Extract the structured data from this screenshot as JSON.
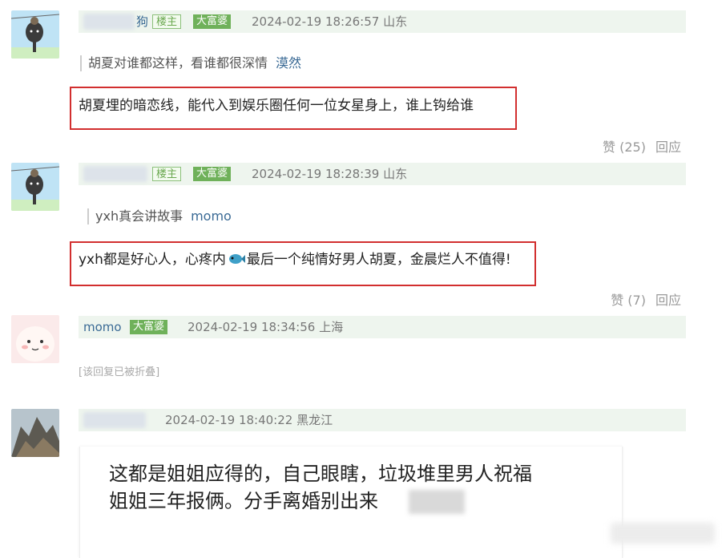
{
  "posts": [
    {
      "user_suffix": "狗",
      "badge_owner": "楼主",
      "badge_rich": "大富婆",
      "time": "2024-02-19 18:26:57 山东",
      "quote": "胡夏对谁都这样，看谁都很深情",
      "quote_user": "漠然",
      "content": "胡夏埋的暗恋线，能代入到娱乐圈任何一位女星身上，谁上钩给谁",
      "like": "赞 (25)",
      "reply": "回应"
    },
    {
      "badge_owner": "楼主",
      "badge_rich": "大富婆",
      "time": "2024-02-19 18:28:39 山东",
      "quote": "yxh真会讲故事",
      "quote_user": "momo",
      "content_a": "yxh都是好心人，心疼内",
      "content_b": "最后一个纯情好男人胡夏，金晨烂人不值得!",
      "like": "赞 (7)",
      "reply": "回应"
    },
    {
      "username": "momo",
      "badge_rich": "大富婆",
      "time": "2024-02-19 18:34:56 上海",
      "folded": "[该回复已被折叠]"
    },
    {
      "time": "2024-02-19 18:40:22 黑龙江",
      "card_line1": "这都是姐姐应得的，自己眼瞎，垃圾堆里男人祝福",
      "card_line2": "姐姐三年报俩。分手离婚别出来"
    }
  ],
  "colors": {
    "meta_bg": "#eef5ee",
    "badge_green": "#6fb15a",
    "red_box": "#d22f2f",
    "link_blue": "#3a6a95"
  }
}
